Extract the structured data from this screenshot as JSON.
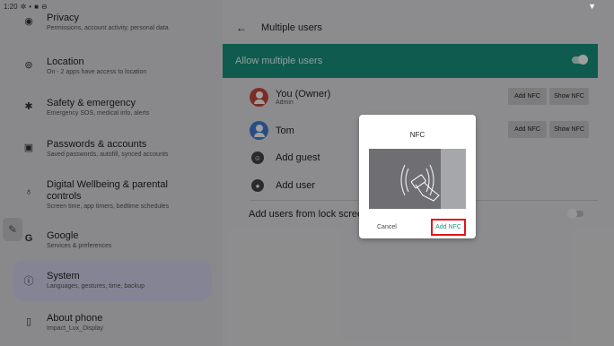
{
  "statusbar": {
    "time": "1:20"
  },
  "sidebar": {
    "items": [
      {
        "icon": "privacy-icon",
        "title": "Privacy",
        "subtitle": "Permissions, account activity, personal data"
      },
      {
        "icon": "location-icon",
        "title": "Location",
        "subtitle": "On - 2 apps have access to location"
      },
      {
        "icon": "emergency-icon",
        "title": "Safety & emergency",
        "subtitle": "Emergency SOS, medical info, alerts"
      },
      {
        "icon": "passwords-icon",
        "title": "Passwords & accounts",
        "subtitle": "Saved passwords, autofill, synced accounts"
      },
      {
        "icon": "wellbeing-icon",
        "title": "Digital Wellbeing & parental controls",
        "subtitle": "Screen time, app timers, bedtime schedules"
      },
      {
        "icon": "google-icon",
        "title": "Google",
        "subtitle": "Services & preferences"
      },
      {
        "icon": "info-icon",
        "title": "System",
        "subtitle": "Languages, gestures, time, backup"
      },
      {
        "icon": "phone-icon",
        "title": "About phone",
        "subtitle": "Impact_Lux_Display"
      }
    ]
  },
  "header": {
    "title": "Multiple users"
  },
  "allow_multiple": {
    "label": "Allow multiple users",
    "enabled": true
  },
  "users": [
    {
      "name": "You (Owner)",
      "subtitle": "Admin",
      "color": "#c9483e",
      "add_nfc": "Add NFC",
      "show_nfc": "Show NFC"
    },
    {
      "name": "Tom",
      "subtitle": "",
      "color": "#3f7fd6",
      "add_nfc": "Add NFC",
      "show_nfc": "Show NFC"
    }
  ],
  "add_guest": "Add guest",
  "add_user": "Add user",
  "lockscreen": {
    "label": "Add users from lock screen",
    "enabled": false
  },
  "dialog": {
    "title": "NFC",
    "cancel": "Cancel",
    "confirm": "Add NFC"
  },
  "colors": {
    "accent": "#1a9480",
    "highlight": "#e1141b"
  }
}
